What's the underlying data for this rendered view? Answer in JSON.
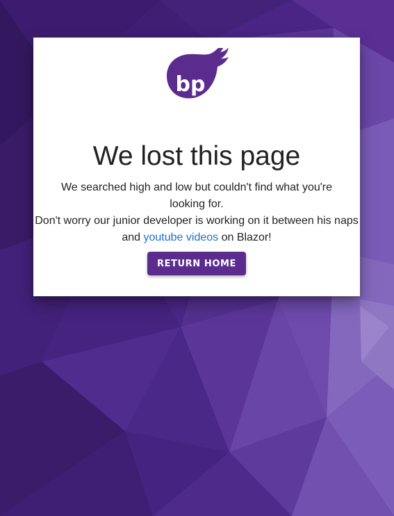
{
  "colors": {
    "background": "#4a2585",
    "card": "#ffffff",
    "brand_purple": "#5b2c8e",
    "link": "#1e6fc9",
    "text": "#212121"
  },
  "logo": {
    "icon": "bp-flame-logo-icon",
    "text": "bp"
  },
  "page": {
    "title": "We lost this page",
    "line1": "We searched high and low but couldn't find what you're looking for.",
    "line2_before": "Don't worry our junior developer is working on it between his naps and ",
    "link_text": "youtube videos",
    "line2_after": " on Blazor!",
    "button_label": "RETURN HOME"
  }
}
